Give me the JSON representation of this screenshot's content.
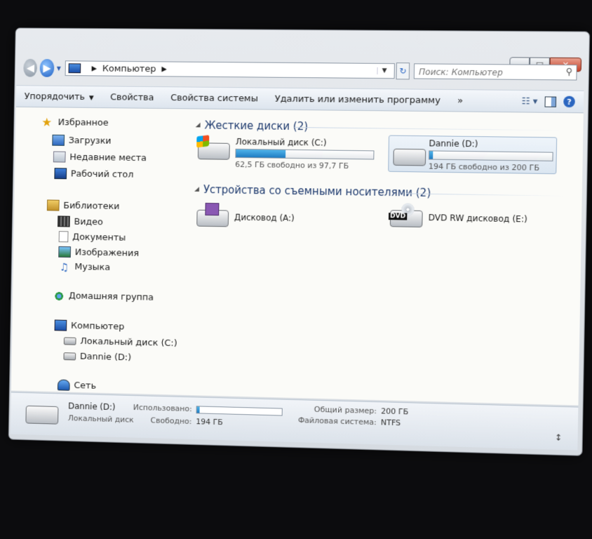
{
  "window": {
    "caption_min": "–",
    "caption_max": "□",
    "caption_close": "✕"
  },
  "navbar": {
    "back_glyph": "◀",
    "forward_glyph": "▶",
    "breadcrumb": "Компьютер",
    "breadcrumb_sep": "▶",
    "breadcrumb_after": "▶",
    "dropdown_glyph": "▼",
    "refresh_glyph": "↻",
    "search_placeholder": "Поиск: Компьютер",
    "search_glyph": "⚲"
  },
  "cmdbar": {
    "organize": "Упорядочить",
    "organize_arrow": "▼",
    "properties": "Свойства",
    "system_properties": "Свойства системы",
    "uninstall": "Удалить или изменить программу",
    "more": "»",
    "view_glyph": "☷ ▾",
    "help_glyph": "?"
  },
  "sidebar": {
    "favorites": "Избранное",
    "downloads": "Загрузки",
    "recent": "Недавние места",
    "desktop": "Рабочий стол",
    "libraries": "Библиотеки",
    "video": "Видео",
    "documents": "Документы",
    "pictures": "Изображения",
    "music": "Музыка",
    "music_glyph": "♫",
    "star_glyph": "★",
    "homegroup": "Домашняя группа",
    "computer": "Компьютер",
    "local_disk": "Локальный диск (C:)",
    "dannie": "Dannie (D:)",
    "network": "Сеть"
  },
  "main": {
    "group_tri": "◢",
    "hdd_header": "Жесткие диски (2)",
    "removable_header": "Устройства со съемными носителями (2)",
    "drives": [
      {
        "name": "Локальный диск (C:)",
        "free_text": "62,5 ГБ свободно из 97,7 ГБ",
        "used_fraction": 0.36
      },
      {
        "name": "Dannie (D:)",
        "free_text": "194 ГБ свободно из 200 ГБ",
        "used_fraction": 0.03
      }
    ],
    "removable": [
      {
        "name": "Дисковод (A:)"
      },
      {
        "name": "DVD RW дисковод (E:)",
        "badge": "DVD"
      }
    ]
  },
  "details": {
    "name": "Dannie (D:)",
    "type": "Локальный диск",
    "used_label": "Использовано:",
    "used_fraction": 0.03,
    "free_label": "Свободно:",
    "free_value": "194 ГБ",
    "total_label": "Общий размер:",
    "total_value": "200 ГБ",
    "fs_label": "Файловая система:",
    "fs_value": "NTFS",
    "grip_glyph": "↕"
  }
}
